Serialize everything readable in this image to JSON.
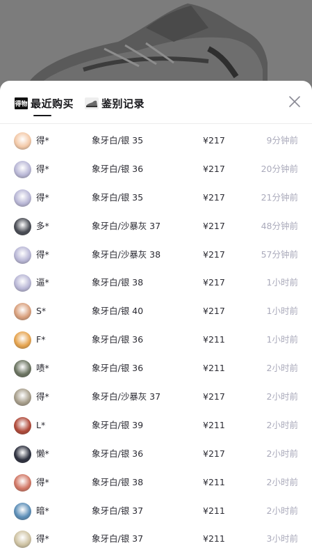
{
  "tabs": [
    {
      "label": "最近购买",
      "logo_text": "得物",
      "active": true
    },
    {
      "label": "鉴别记录",
      "icon": "sneaker-icon",
      "active": false
    }
  ],
  "close_icon": "close-icon",
  "records": [
    {
      "name": "得*",
      "spec": "象牙白/银 35",
      "price": "¥217",
      "time": "9分钟前",
      "avatar_color": "#f3c9a8"
    },
    {
      "name": "得*",
      "spec": "象牙白/银 36",
      "price": "¥217",
      "time": "20分钟前",
      "avatar_color": "#b9b7d6"
    },
    {
      "name": "得*",
      "spec": "象牙白/银 35",
      "price": "¥217",
      "time": "21分钟前",
      "avatar_color": "#b9b7d6"
    },
    {
      "name": "多*",
      "spec": "象牙白/沙暴灰 37",
      "price": "¥217",
      "time": "48分钟前",
      "avatar_color": "#4a4d55"
    },
    {
      "name": "得*",
      "spec": "象牙白/沙暴灰 38",
      "price": "¥217",
      "time": "57分钟前",
      "avatar_color": "#b9b7d6"
    },
    {
      "name": "逼*",
      "spec": "象牙白/银 38",
      "price": "¥217",
      "time": "1小时前",
      "avatar_color": "#b9b7d6"
    },
    {
      "name": "S*",
      "spec": "象牙白/银 40",
      "price": "¥217",
      "time": "1小时前",
      "avatar_color": "#d9a07d"
    },
    {
      "name": "F*",
      "spec": "象牙白/银 36",
      "price": "¥211",
      "time": "1小时前",
      "avatar_color": "#e6a44f"
    },
    {
      "name": "啧*",
      "spec": "象牙白/银 36",
      "price": "¥211",
      "time": "2小时前",
      "avatar_color": "#6c7562"
    },
    {
      "name": "得*",
      "spec": "象牙白/沙暴灰 37",
      "price": "¥217",
      "time": "2小时前",
      "avatar_color": "#a89f8c"
    },
    {
      "name": "L*",
      "spec": "象牙白/银 39",
      "price": "¥211",
      "time": "2小时前",
      "avatar_color": "#b04a3a"
    },
    {
      "name": "懒*",
      "spec": "象牙白/银 36",
      "price": "¥217",
      "time": "2小时前",
      "avatar_color": "#2f3240"
    },
    {
      "name": "得*",
      "spec": "象牙白/银 38",
      "price": "¥211",
      "time": "2小时前",
      "avatar_color": "#d27866"
    },
    {
      "name": "暗*",
      "spec": "象牙白/银 37",
      "price": "¥211",
      "time": "2小时前",
      "avatar_color": "#5d8fb8"
    },
    {
      "name": "得*",
      "spec": "象牙白/银 37",
      "price": "¥211",
      "time": "3小时前",
      "avatar_color": "#cfc3a3"
    }
  ]
}
